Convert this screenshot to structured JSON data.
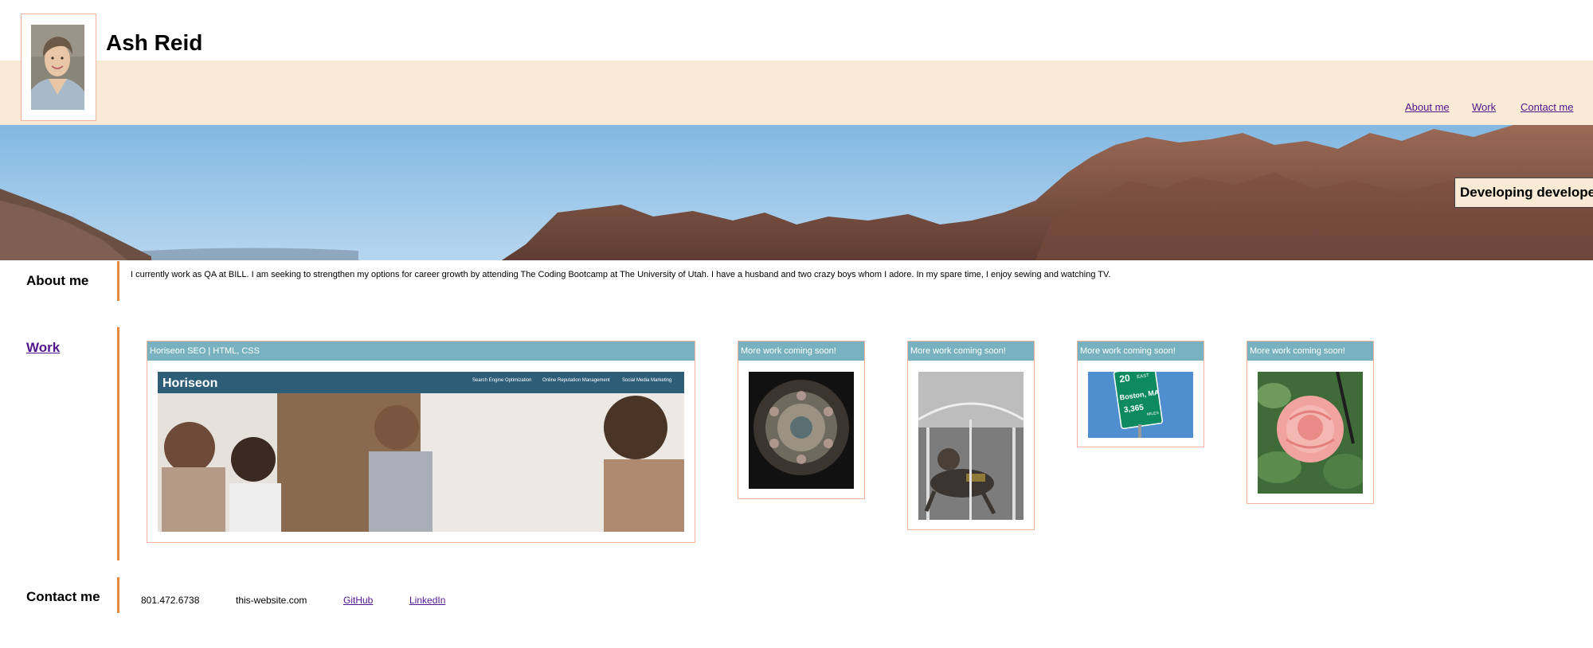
{
  "header": {
    "name": "Ash Reid",
    "nav": [
      {
        "label": "About me"
      },
      {
        "label": "Work"
      },
      {
        "label": "Contact me"
      }
    ]
  },
  "hero": {
    "tagline": "Developing developer"
  },
  "about": {
    "heading": "About me",
    "text": "I currently work as QA at BILL. I am seeking to strengthen my options for career growth by attending The Coding Bootcamp at The University of Utah. I have a husband and two crazy boys whom I adore. In my spare time, I enjoy sewing and watching TV."
  },
  "work": {
    "heading": "Work",
    "featured": {
      "title": "Horiseon SEO | HTML, CSS",
      "screenshot": {
        "logo": "Horiseon",
        "nav": [
          "Search Engine Optimization",
          "Online Reputation Management",
          "Social Media Marketing"
        ]
      }
    },
    "upcoming": [
      {
        "title": "More work coming soon!"
      },
      {
        "title": "More work coming soon!"
      },
      {
        "title": "More work coming soon!",
        "sign": {
          "route": "20",
          "dir": "EAST",
          "city": "Boston, MA",
          "miles": "3,365",
          "unit": "MILES"
        }
      },
      {
        "title": "More work coming soon!"
      }
    ]
  },
  "contact": {
    "heading": "Contact me",
    "phone": "801.472.6738",
    "website": "this-website.com",
    "github": "GitHub",
    "linkedin": "LinkedIn"
  },
  "colors": {
    "header_band": "#f9ead5",
    "accent_bar": "#e68a3c",
    "card_header": "#78b2c0",
    "card_border": "#f2b49c",
    "link": "#52158f"
  }
}
